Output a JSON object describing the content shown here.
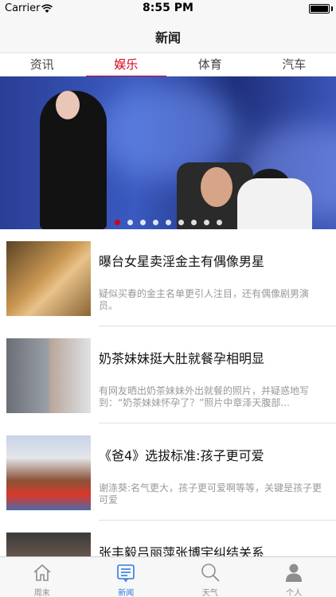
{
  "status_bar": {
    "carrier": "Carrier",
    "time": "8:55 PM"
  },
  "nav": {
    "title": "新闻"
  },
  "tabs": [
    {
      "label": "资讯",
      "active": false
    },
    {
      "label": "娱乐",
      "active": true
    },
    {
      "label": "体育",
      "active": false
    },
    {
      "label": "汽车",
      "active": false
    }
  ],
  "banner": {
    "page_count": 9,
    "active_page": 1
  },
  "news": [
    {
      "title": "曝台女星卖淫金主有偶像男星",
      "summary": "疑似买春的金主名单更引人注目，还有偶像剧男演员。"
    },
    {
      "title": "奶茶妹妹挺大肚就餐孕相明显",
      "summary": "有网友晒出奶茶妹妹外出就餐的照片，并疑惑地写到：“奶茶妹妹怀孕了？”照片中章泽天腹部..."
    },
    {
      "title": "《爸4》选拔标准:孩子更可爱",
      "summary": "谢涤葵:名气更大，孩子更可爱啊等等，关键是孩子更可爱"
    },
    {
      "title": "张丰毅吕丽萍张博宇纠结关系",
      "summary": ""
    }
  ],
  "tab_bar": [
    {
      "label": "周末",
      "icon": "home-icon",
      "active": false
    },
    {
      "label": "新闻",
      "icon": "news-icon",
      "active": true
    },
    {
      "label": "天气",
      "icon": "search-icon",
      "active": false
    },
    {
      "label": "个人",
      "icon": "person-icon",
      "active": false
    }
  ],
  "colors": {
    "accent": "#d0021b",
    "tab_active": "#2f7de1",
    "summary_text": "#999999"
  }
}
